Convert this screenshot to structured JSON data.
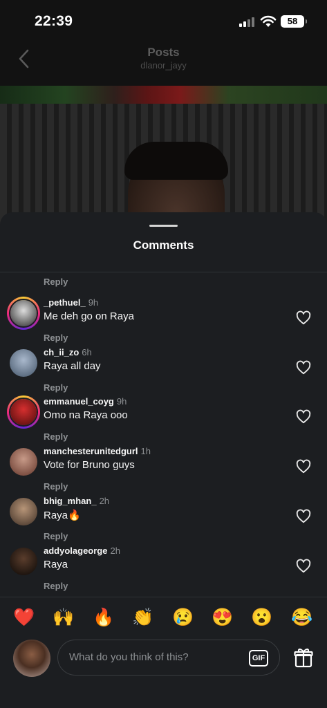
{
  "status_bar": {
    "time": "22:39",
    "battery": "58"
  },
  "header": {
    "title": "Posts",
    "username": "dlanor_jayy"
  },
  "comments_sheet": {
    "title": "Comments",
    "top_reply_label": "Reply",
    "comments": [
      {
        "username": "_pethuel_",
        "time": "9h",
        "text": "Me deh go on Raya",
        "reply": "Reply",
        "avatar_colors": [
          "#dcdcdc",
          "#3b3b3b"
        ],
        "story_ring": true
      },
      {
        "username": "ch_ii_zo",
        "time": "6h",
        "text": "Raya all day",
        "reply": "Reply",
        "avatar_colors": [
          "#a9b8cc",
          "#4e5f73"
        ],
        "story_ring": false
      },
      {
        "username": "emmanuel_coyg",
        "time": "9h",
        "text": "Omo na Raya ooo",
        "reply": "Reply",
        "avatar_colors": [
          "#d62f2f",
          "#5a0f0f"
        ],
        "story_ring": true
      },
      {
        "username": "manchesterunitedgurl",
        "time": "1h",
        "text": "Vote for Bruno guys",
        "reply": "Reply",
        "avatar_colors": [
          "#c79a88",
          "#6e4034"
        ],
        "story_ring": false
      },
      {
        "username": "bhig_mhan_",
        "time": "2h",
        "text": "Raya🔥",
        "reply": "Reply",
        "avatar_colors": [
          "#b79578",
          "#4b3a2e"
        ],
        "story_ring": false
      },
      {
        "username": "addyolageorge",
        "time": "2h",
        "text": "Raya",
        "reply": "Reply",
        "avatar_colors": [
          "#5a3d2c",
          "#120d0a"
        ],
        "story_ring": false
      }
    ]
  },
  "emoji_bar": [
    "❤️",
    "🙌",
    "🔥",
    "👏",
    "😢",
    "😍",
    "😮",
    "😂"
  ],
  "composer": {
    "placeholder": "What do you think of this?",
    "gif_label": "GIF"
  }
}
